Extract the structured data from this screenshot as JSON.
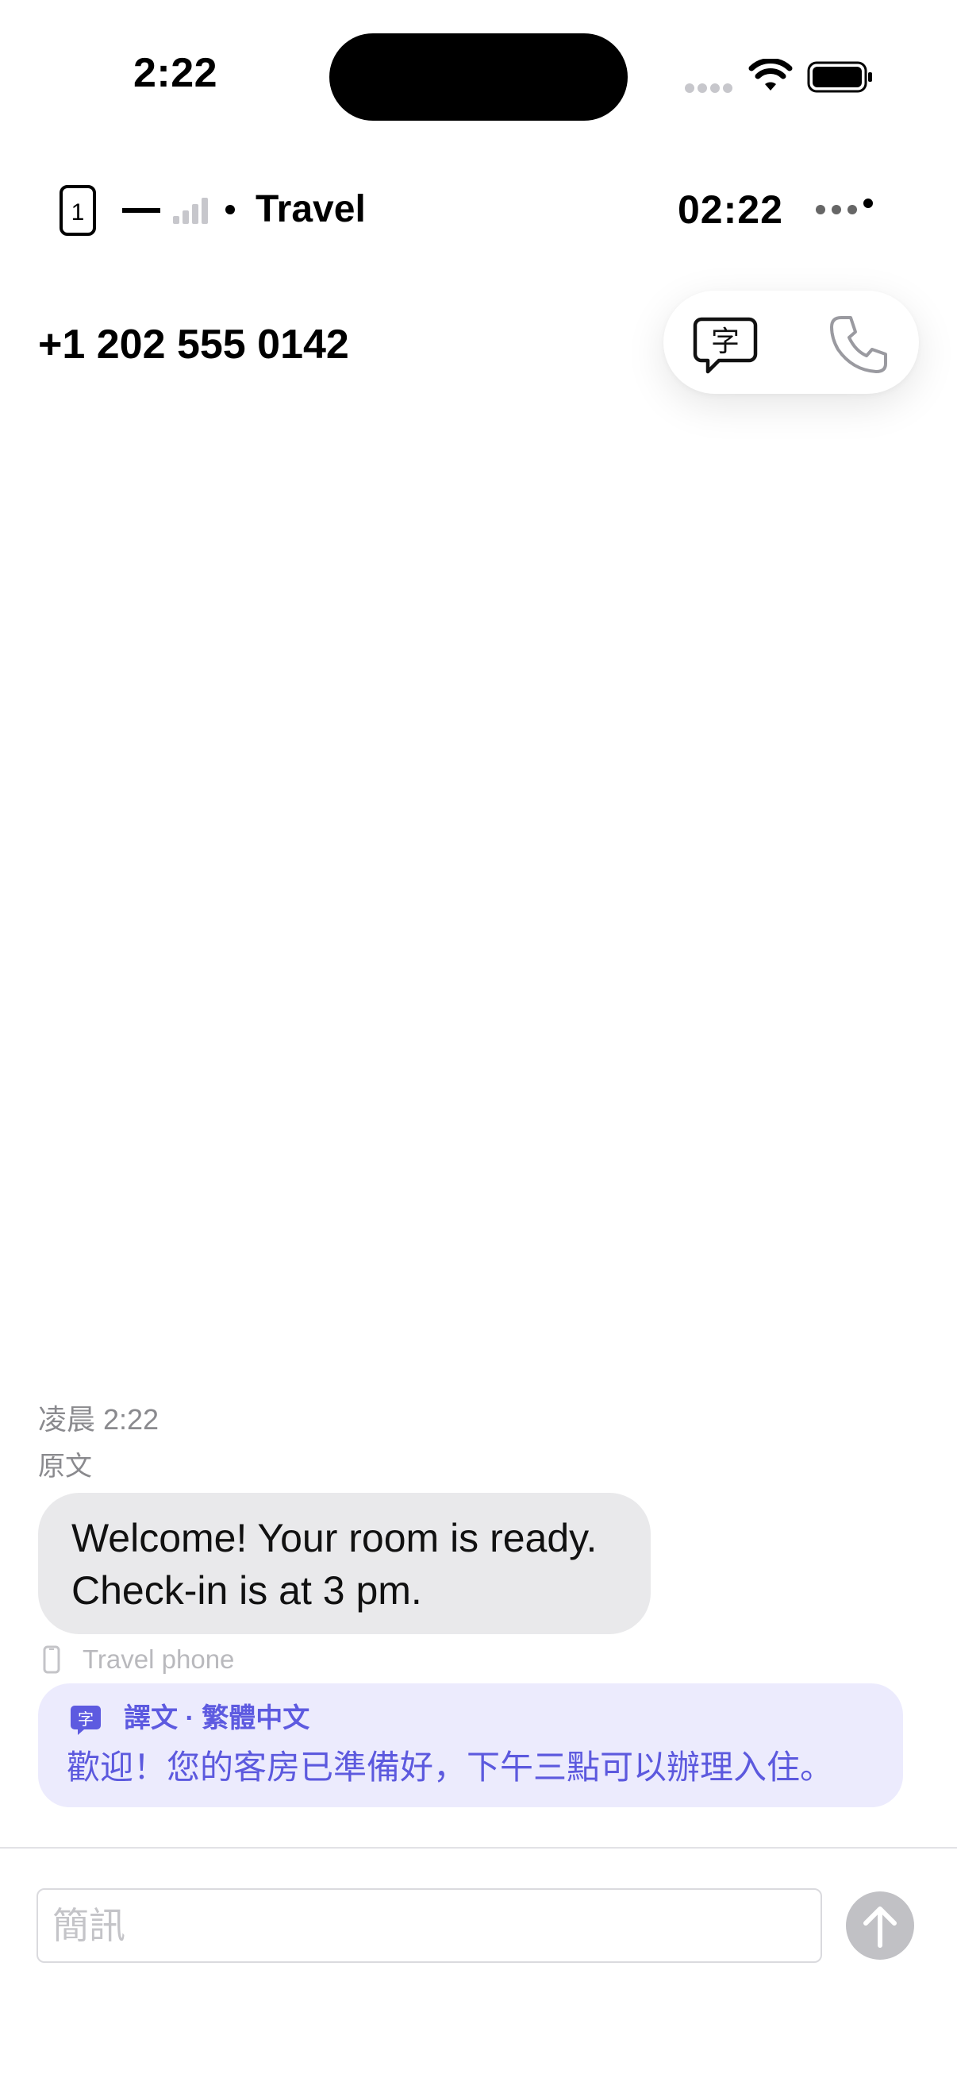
{
  "status_bar": {
    "time": "2:22"
  },
  "header": {
    "line_name": "Travel",
    "call_timer": "02:22"
  },
  "contact": {
    "phone_number": "+1 202 555 0142"
  },
  "conversation": {
    "timestamp": "凌晨 2:22",
    "original_label": "原文",
    "message_lines": [
      "Welcome! Your room is ready.",
      "Check-in is at 3 pm."
    ],
    "via_line": "Travel phone",
    "translation": {
      "label": "譯文 · 繁體中文",
      "badge_char": "字",
      "text": "歡迎！您的客房已準備好，下午三點可以辦理入住。"
    }
  },
  "composer": {
    "placeholder": "簡訊",
    "value": ""
  },
  "colors": {
    "accent": "#5d5ae0",
    "translation_bg": "#ecebfd",
    "bubble_bg": "#e9e9eb",
    "send_disabled": "#c1c1c5"
  }
}
